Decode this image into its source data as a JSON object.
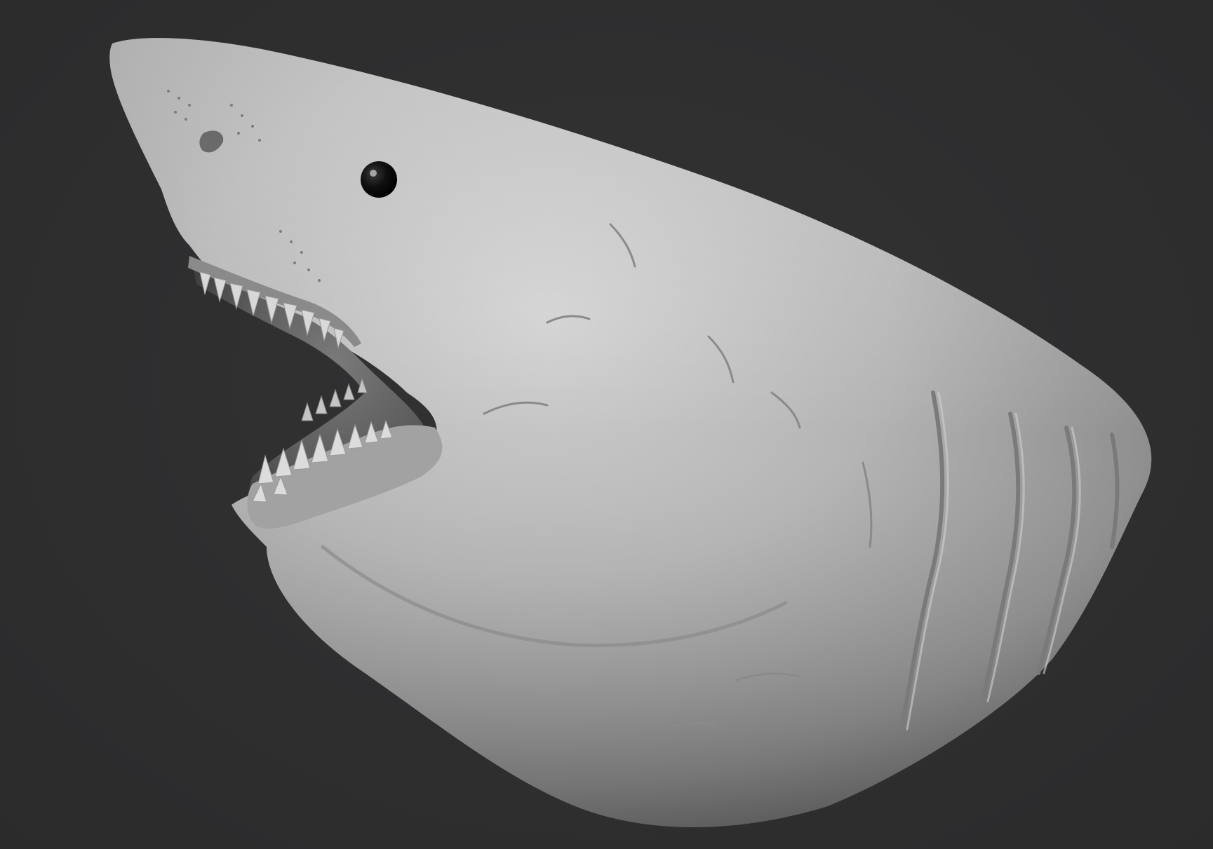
{
  "scene": {
    "background_color": "#2f2f30",
    "subject": "shark-head-sculpt",
    "material_color": "#b5b5b5",
    "eye_color": "#0a0a0a"
  }
}
